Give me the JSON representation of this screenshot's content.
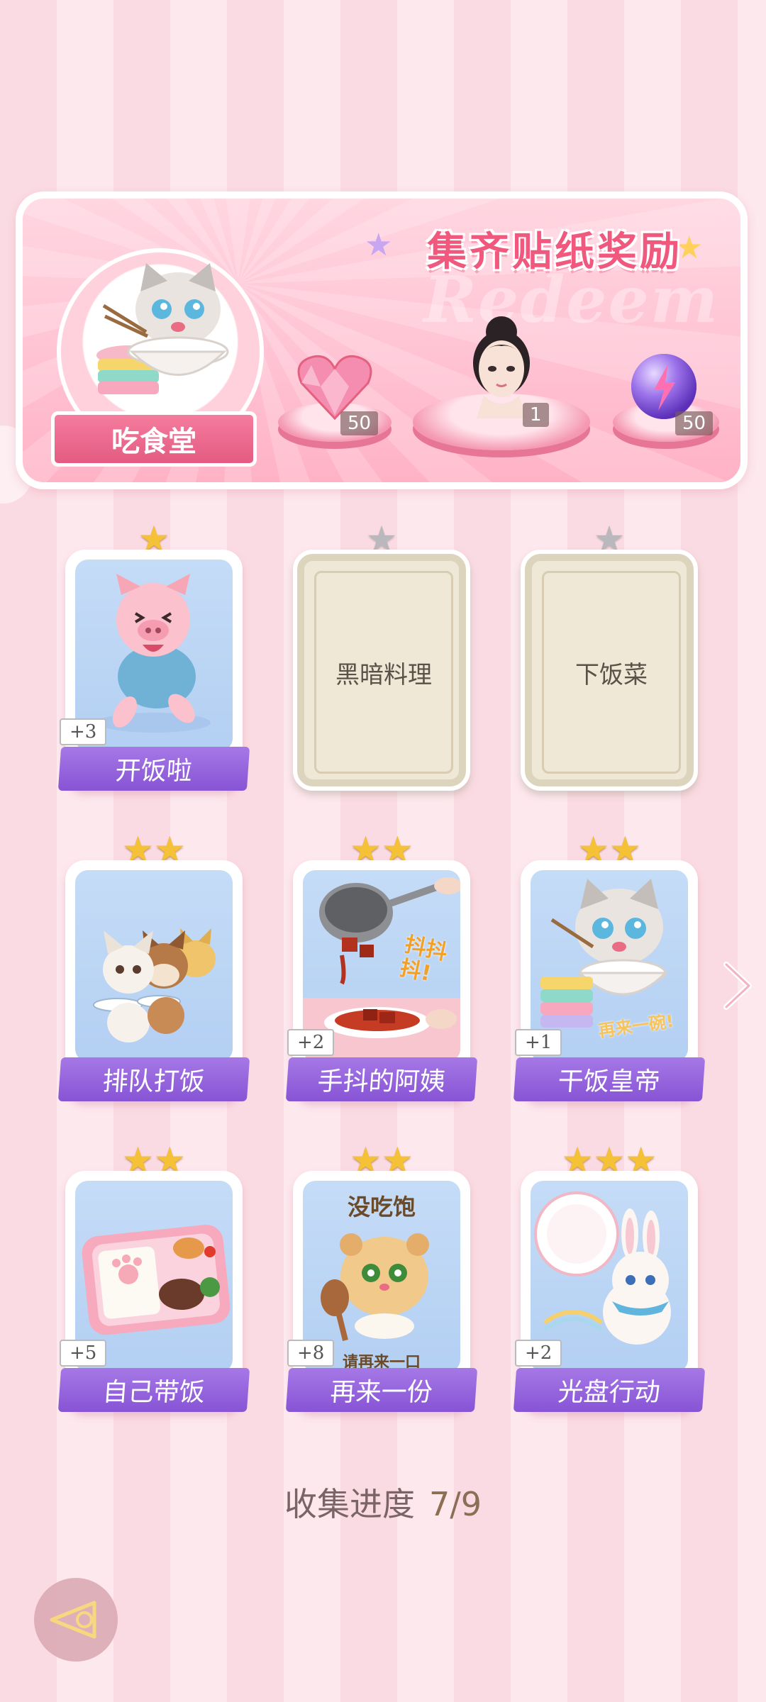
{
  "banner": {
    "title": "集齐贴纸奖励",
    "watermark": "Redeem",
    "album_label": "吃食堂",
    "album_sticker_text": "再来一碗!",
    "rewards": [
      {
        "icon": "pink-heart-gem-icon",
        "count": "50"
      },
      {
        "icon": "girl-portrait-icon",
        "count": "1"
      },
      {
        "icon": "purple-energy-orb-icon",
        "count": "50"
      }
    ]
  },
  "cards": [
    {
      "name": "开饭啦",
      "stars": 1,
      "bonus": "+3",
      "collected": true,
      "art": "pig-running-icon"
    },
    {
      "name": "黑暗料理",
      "stars": 1,
      "bonus": "",
      "collected": false,
      "art": ""
    },
    {
      "name": "下饭菜",
      "stars": 1,
      "bonus": "",
      "collected": false,
      "art": ""
    },
    {
      "name": "排队打饭",
      "stars": 2,
      "bonus": "",
      "collected": true,
      "art": "animals-queue-icon"
    },
    {
      "name": "手抖的阿姨",
      "stars": 2,
      "bonus": "+2",
      "collected": true,
      "art": "ladle-serving-icon",
      "art_text": "抖抖抖!"
    },
    {
      "name": "干饭皇帝",
      "stars": 2,
      "bonus": "+1",
      "collected": true,
      "art": "cat-eating-icon",
      "art_text": "再来一碗!"
    },
    {
      "name": "自己带饭",
      "stars": 2,
      "bonus": "+5",
      "collected": true,
      "art": "bento-box-icon"
    },
    {
      "name": "再来一份",
      "stars": 2,
      "bonus": "+8",
      "collected": true,
      "art": "hamster-spoon-icon",
      "art_text": "没吃饱",
      "art_text2": "请再来一口"
    },
    {
      "name": "光盘行动",
      "stars": 3,
      "bonus": "+2",
      "collected": true,
      "art": "bunny-plate-icon"
    }
  ],
  "progress": {
    "label": "收集进度",
    "value": "7/9"
  },
  "colors": {
    "accent": "#f0587e",
    "name_plate": "#8754d5",
    "star": "#f5c237"
  }
}
